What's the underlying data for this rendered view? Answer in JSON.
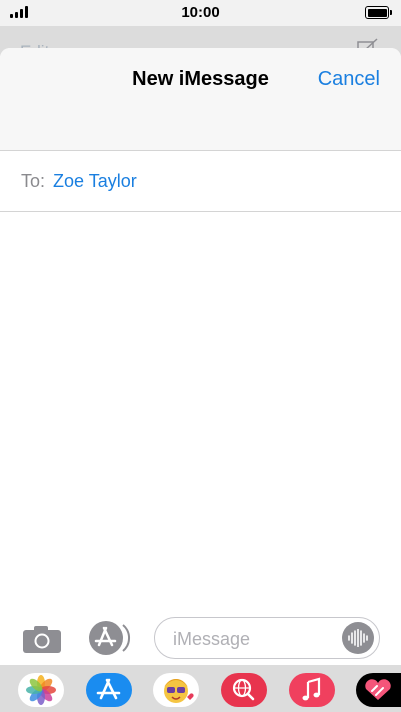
{
  "status_bar": {
    "time": "10:00"
  },
  "underlay": {
    "edit_label": "Edit"
  },
  "sheet": {
    "title": "New iMessage",
    "cancel_label": "Cancel"
  },
  "recipient": {
    "to_label": "To:",
    "name": "Zoe Taylor"
  },
  "compose": {
    "placeholder": "iMessage",
    "value": ""
  },
  "app_drawer": {
    "apps": [
      "photos-icon",
      "app-store-icon",
      "memoji-icon",
      "web-search-icon",
      "music-icon",
      "digital-touch-icon"
    ]
  },
  "colors": {
    "accent": "#1a7fe0",
    "header_bg": "#f7f7f7",
    "drawer_bg": "#dcdcdc"
  }
}
